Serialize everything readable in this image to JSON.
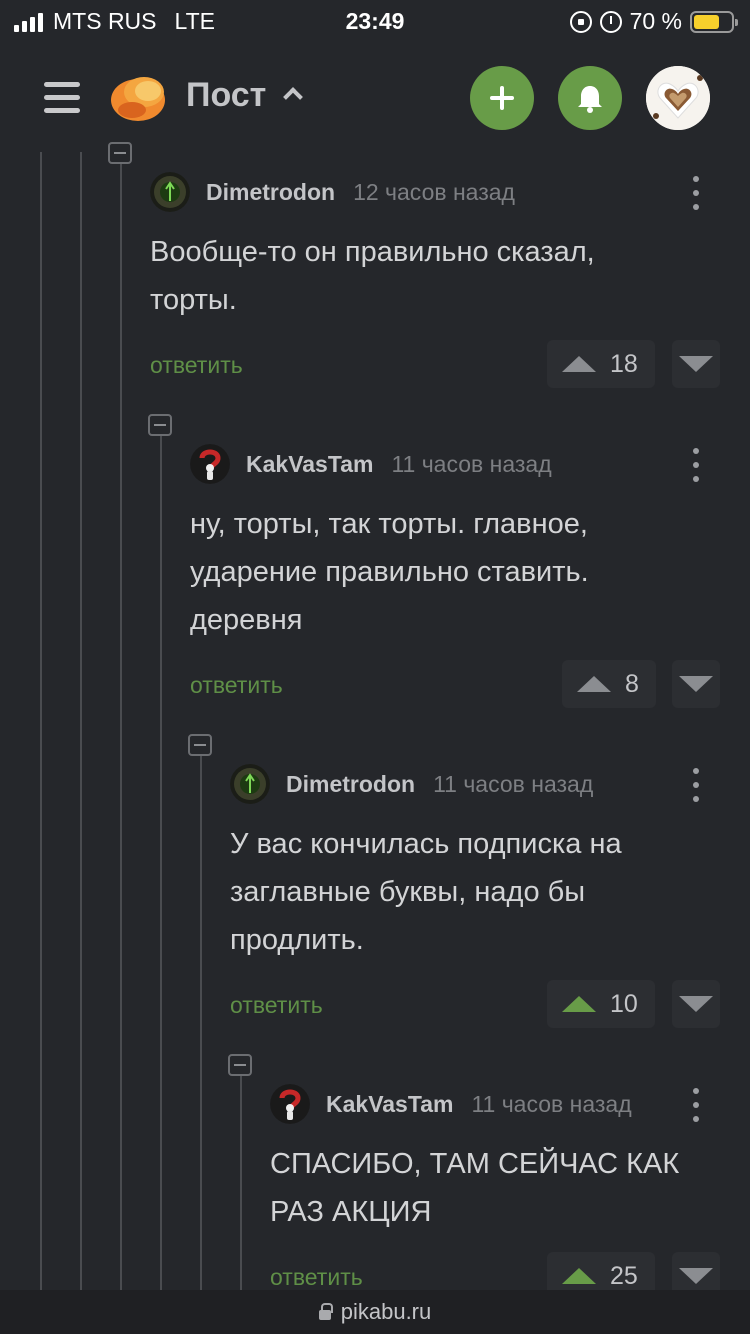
{
  "status_bar": {
    "carrier": "MTS RUS",
    "network": "LTE",
    "time": "23:49",
    "battery": "70 %",
    "battery_level": 0.7,
    "icons": [
      "signal-icon",
      "lock-rotation-icon",
      "alarm-icon",
      "battery-icon"
    ]
  },
  "header": {
    "title": "Пост",
    "add_button_icon": "plus-icon",
    "notifications_icon": "bell-icon",
    "accent_color": "#689c48"
  },
  "comments": [
    {
      "user": "Dimetrodon",
      "time": "12 часов назад",
      "text_lines": [
        "Вообще-то он правильно сказал,",
        "торты."
      ],
      "reply": "ответить",
      "rating": "18",
      "upvoted": false
    },
    {
      "user": "KakVasTam",
      "time": "11 часов назад",
      "text_lines": [
        "ну, торты, так торты. главное,",
        "ударение правильно ставить.",
        "деревня"
      ],
      "reply": "ответить",
      "rating": "8",
      "upvoted": false
    },
    {
      "user": "Dimetrodon",
      "time": "11 часов назад",
      "text_lines": [
        "У вас кончилась подписка на",
        "заглавные буквы, надо бы",
        "продлить."
      ],
      "reply": "ответить",
      "rating": "10",
      "upvoted": true
    },
    {
      "user": "KakVasTam",
      "time": "11 часов назад",
      "text_lines": [
        "СПАСИБО, ТАМ СЕЙЧАС КАК",
        "РАЗ АКЦИЯ"
      ],
      "reply": "ответить",
      "rating": "25",
      "upvoted": true
    }
  ],
  "url_bar": {
    "url": "pikabu.ru"
  }
}
